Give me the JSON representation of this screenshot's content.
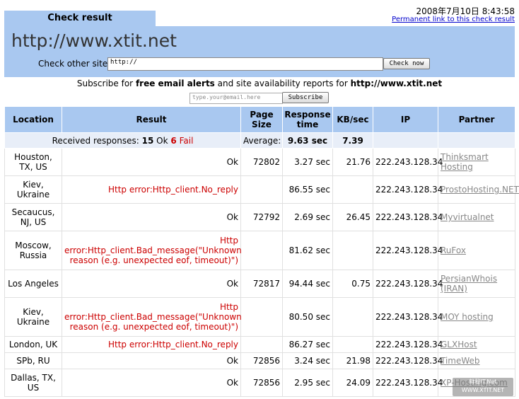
{
  "tab_title": "Check result",
  "timestamp": "2008年7月10日 8:43:58",
  "permalink_text": "Permanent link to this check result",
  "site_title": "http://www.xtit.net",
  "check_other": {
    "label": "Check other site:",
    "value": "http://",
    "button": "Check now"
  },
  "subscribe": {
    "pre": "Subscribe for ",
    "bold": "free email alerts",
    "mid": " and site availability reports for ",
    "site": "http://www.xtit.net",
    "email_placeholder": "type.your@email.here",
    "button": "Subscribe"
  },
  "columns": [
    "Location",
    "Result",
    "Page Size",
    "Response time",
    "KB/sec",
    "IP",
    "Partner"
  ],
  "summary": {
    "received_label": "Received responses:",
    "ok_count": "15",
    "ok_label": "Ok",
    "fail_count": "6",
    "fail_label": "Fail",
    "average_label": "Average:",
    "avg_response": "9.63 sec",
    "avg_kbsec": "7.39"
  },
  "rows": [
    {
      "location": "Houston, TX, US",
      "result": "Ok",
      "is_error": false,
      "size": "72802",
      "time": "3.27 sec",
      "kbsec": "21.76",
      "ip": "222.243.128.34",
      "partner": "Thinksmart Hosting"
    },
    {
      "location": "Kiev, Ukraine",
      "result": "Http error:Http_client.No_reply",
      "is_error": true,
      "size": "",
      "time": "86.55 sec",
      "kbsec": "",
      "ip": "222.243.128.34",
      "partner": "ProstoHosting.NET"
    },
    {
      "location": "Secaucus, NJ, US",
      "result": "Ok",
      "is_error": false,
      "size": "72792",
      "time": "2.69 sec",
      "kbsec": "26.45",
      "ip": "222.243.128.34",
      "partner": "Myvirtualnet"
    },
    {
      "location": "Moscow, Russia",
      "result": "Http error:Http_client.Bad_message(\"Unknown reason (e.g. unexpected eof, timeout)\")",
      "is_error": true,
      "size": "",
      "time": "81.62 sec",
      "kbsec": "",
      "ip": "222.243.128.34",
      "partner": "RuFox"
    },
    {
      "location": "Los Angeles",
      "result": "Ok",
      "is_error": false,
      "size": "72817",
      "time": "94.44 sec",
      "kbsec": "0.75",
      "ip": "222.243.128.34",
      "partner": "PersianWhois (IRAN)"
    },
    {
      "location": "Kiev, Ukraine",
      "result": "Http error:Http_client.Bad_message(\"Unknown reason (e.g. unexpected eof, timeout)\")",
      "is_error": true,
      "size": "",
      "time": "80.50 sec",
      "kbsec": "",
      "ip": "222.243.128.34",
      "partner": "MOY hosting"
    },
    {
      "location": "London, UK",
      "result": "Http error:Http_client.No_reply",
      "is_error": true,
      "size": "",
      "time": "86.27 sec",
      "kbsec": "",
      "ip": "222.243.128.34",
      "partner": "GLXHost"
    },
    {
      "location": "SPb, RU",
      "result": "Ok",
      "is_error": false,
      "size": "72856",
      "time": "3.24 sec",
      "kbsec": "21.98",
      "ip": "222.243.128.34",
      "partner": "TimeWeb"
    },
    {
      "location": "Dallas, TX, US",
      "result": "Ok",
      "is_error": false,
      "size": "72856",
      "time": "2.95 sec",
      "kbsec": "24.09",
      "ip": "222.243.128.34",
      "partner": "XP-Hosting.com"
    }
  ],
  "watermark": {
    "line1": "鲜秘IT.Net",
    "line2": "WWW.XTIT.NET"
  },
  "colors": {
    "panel_blue": "#a9c8f0",
    "error_red": "#cc0000",
    "link_blue": "#0000cc"
  }
}
